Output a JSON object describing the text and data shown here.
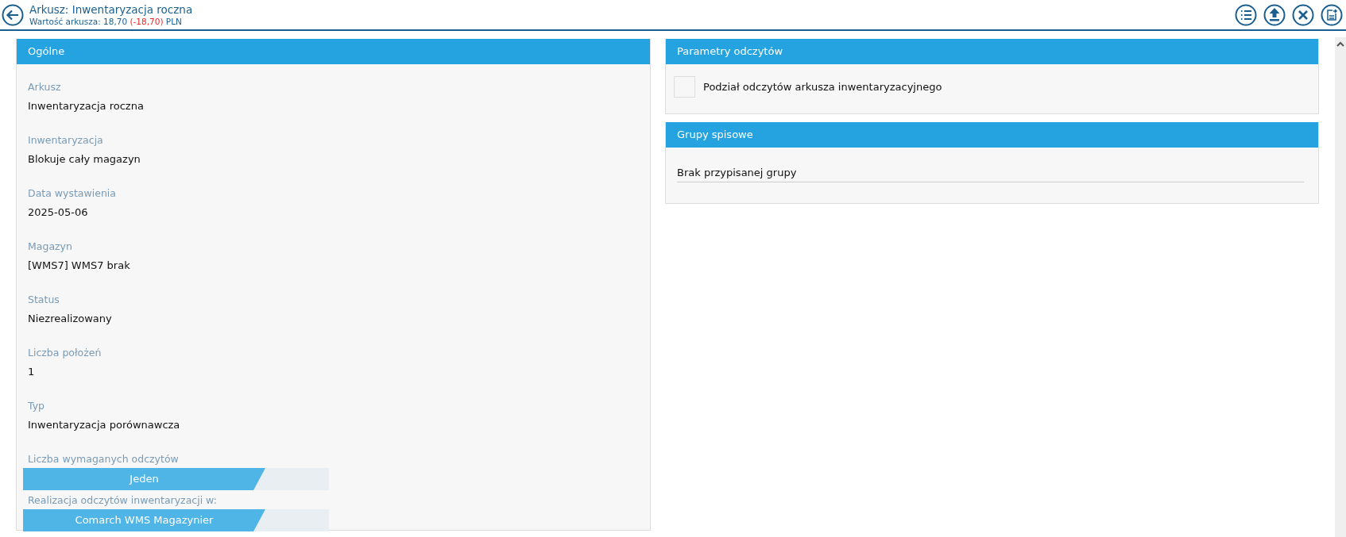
{
  "header": {
    "title": "Arkusz: Inwentaryzacja roczna",
    "subtitle": {
      "label": "Wartość arkusza: 18,70",
      "difference": "(-18,70)",
      "currency": "PLN"
    }
  },
  "toolbar": [
    {
      "kind": "list"
    },
    {
      "kind": "upload"
    },
    {
      "kind": "close"
    },
    {
      "kind": "export"
    }
  ],
  "general": {
    "title": "Ogólne",
    "fields": [
      {
        "label": "Arkusz",
        "value": "Inwentaryzacja roczna"
      },
      {
        "label": "Inwentaryzacja",
        "value": "Blokuje cały magazyn"
      },
      {
        "label": "Data wystawienia",
        "value": "2025-05-06"
      },
      {
        "label": "Magazyn",
        "value": "[WMS7] WMS7 brak"
      },
      {
        "label": "Status",
        "value": "Niezrealizowany"
      },
      {
        "label": "Liczba położeń",
        "value": "1"
      },
      {
        "label": "Typ",
        "value": "Inwentaryzacja porównawcza"
      }
    ],
    "selectors": [
      {
        "label": "Liczba wymaganych odczytów",
        "value": "Jeden"
      },
      {
        "label": "Realizacja odczytów inwentaryzacji w:",
        "value": "Comarch WMS Magazynier"
      }
    ]
  },
  "read_params": {
    "title": "Parametry odczytów",
    "options": [
      {
        "label": "Podział odczytów arkusza inwentaryzacyjnego",
        "checked": false
      }
    ]
  },
  "groups": {
    "title": "Grupy spisowe",
    "value": "Brak przypisanej grupy"
  }
}
